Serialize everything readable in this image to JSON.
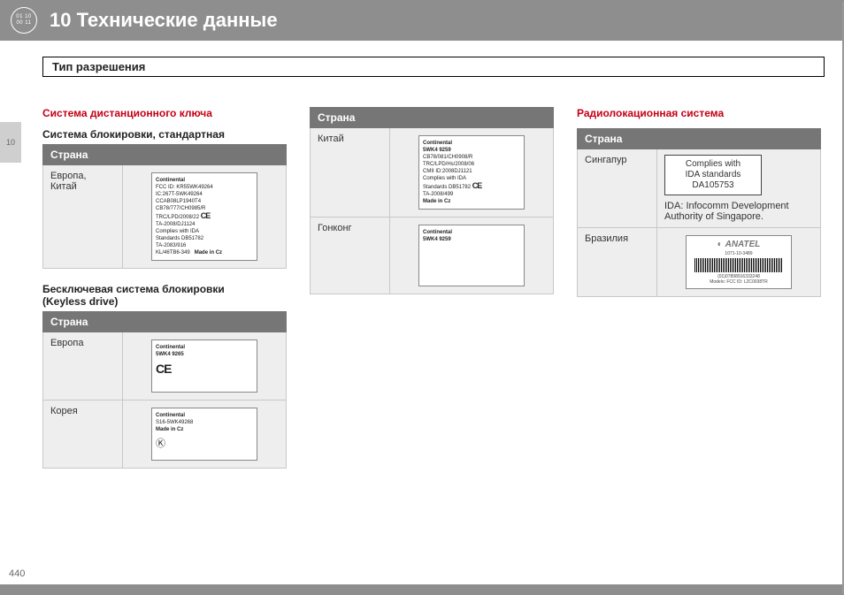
{
  "header": {
    "icon_text_top": "01 10",
    "icon_text_bottom": "00 11",
    "chapter_title": "10 Технические данные"
  },
  "side_tab": "10",
  "page_number": "440",
  "section_bar": "Тип разрешения",
  "col1": {
    "red_heading": "Система дистанционного ключа",
    "sub_heading_1": "Система блокировки, стандартная",
    "table1_header": "Страна",
    "table1_row1_country": "Европа, Китай",
    "label1": {
      "brand": "Continental",
      "l1": "FCC ID: KR55WK49264",
      "l2": "IC:267T-5WK49264",
      "l3": "CCAB08LP1940T4",
      "l4": "CB78/777/CH0985/R",
      "l5": "TRC/LPD/2008/22",
      "l6": "TA-2008/DJ1124",
      "l7": "Complies with IDA",
      "l8": "Standards DB51782",
      "l9": "TA-2083/916",
      "l10": "KL/46TB6-349",
      "made": "Made in Cz"
    },
    "sub_heading_2a": "Бесключевая система блокировки",
    "sub_heading_2b": "(Keyless drive)",
    "table2_header": "Страна",
    "table2_row1_country": "Европа",
    "label2": {
      "brand": "Continental",
      "model": "5WK4 9265"
    },
    "table2_row2_country": "Корея",
    "label3": {
      "brand": "Continental",
      "model": "S16-5WK49268",
      "made": "Made in Cz"
    }
  },
  "col2": {
    "table_header": "Страна",
    "row1_country": "Китай",
    "label_cn": {
      "brand": "Continental",
      "model": "5WK4 9259",
      "l1": "CB78/081/CH0908/R",
      "l2": "TRC/LPD/Hs/2008/06",
      "l3": "CMII ID:2008DJ1121",
      "l4": "Complies with IDA",
      "l5": "Standards DB51782",
      "l6": "TA-2008/499",
      "made": "Made in Cz"
    },
    "row2_country": "Гонконг",
    "label_hk": {
      "brand": "Continental",
      "model": "5WK4 9259"
    }
  },
  "col3": {
    "red_heading": "Радиолокационная система",
    "table_header": "Страна",
    "row1_country": "Сингапур",
    "ida_box_l1": "Complies with",
    "ida_box_l2": "IDA standards",
    "ida_box_l3": "DA105753",
    "ida_note": "IDA: Infocomm Development Authority of Singapore.",
    "row2_country": "Бразилия",
    "anatel_logo": "ANATEL",
    "anatel_code_top": "1071-10-3489",
    "anatel_barcode_num": "(01)07898916333248",
    "anatel_sub": "Modelo: FCC ID: L2C0038TR"
  }
}
